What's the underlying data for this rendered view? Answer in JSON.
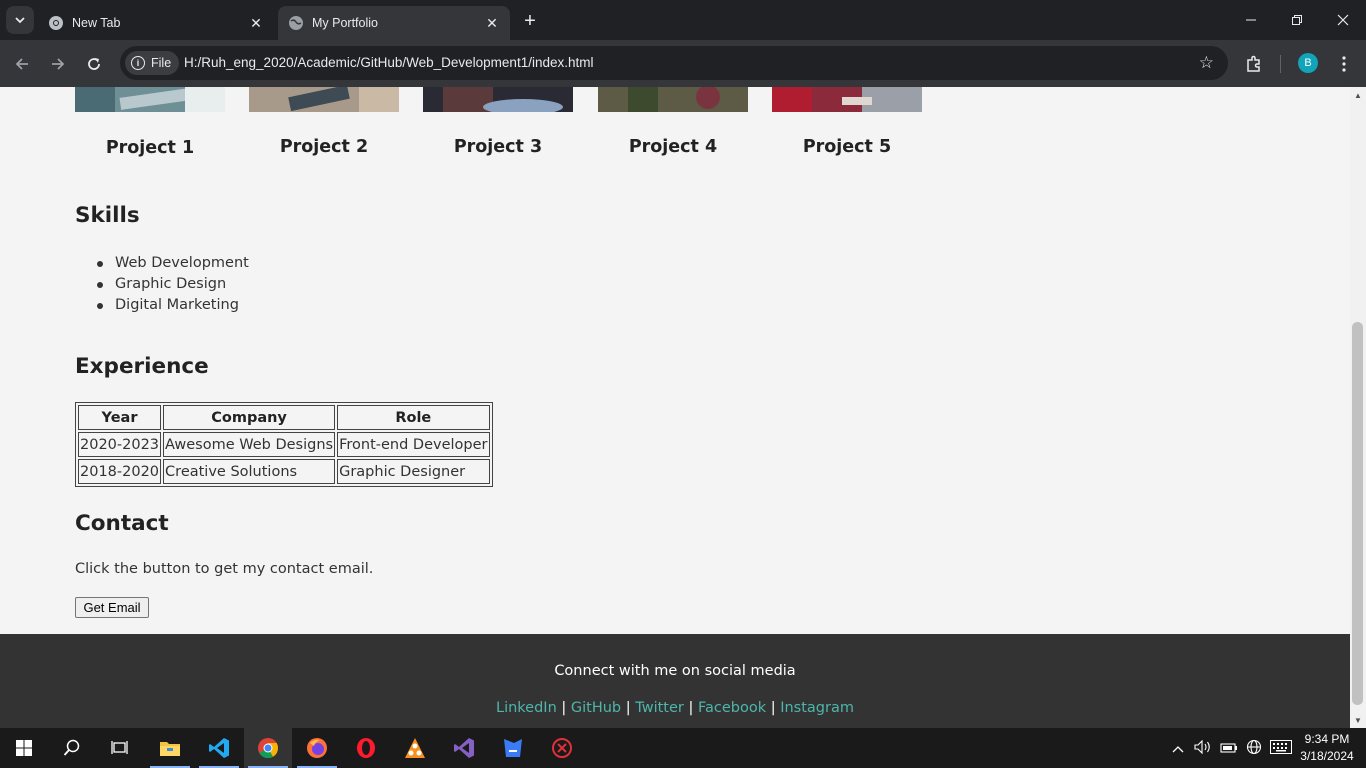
{
  "browser": {
    "tabs": [
      {
        "title": "New Tab",
        "active": false,
        "icon": "chrome-icon"
      },
      {
        "title": "My Portfolio",
        "active": true,
        "icon": "globe-icon"
      }
    ],
    "site_chip": "File",
    "url": "H:/Ruh_eng_2020/Academic/GitHub/Web_Development1/index.html",
    "profile_initial": "B",
    "colors": {
      "frame": "#202124",
      "toolbar": "#35363a",
      "avatar": "#12a4b8"
    }
  },
  "page": {
    "projects": [
      {
        "title": "Project 1",
        "color": "#6f8f96"
      },
      {
        "title": "Project 2",
        "color": "#a89a8a"
      },
      {
        "title": "Project 3",
        "color": "#5a6a80"
      },
      {
        "title": "Project 4",
        "color": "#5d5a45"
      },
      {
        "title": "Project 5",
        "color": "#8a2a3a"
      }
    ],
    "skills": {
      "heading": "Skills",
      "items": [
        "Web Development",
        "Graphic Design",
        "Digital Marketing"
      ]
    },
    "experience": {
      "heading": "Experience",
      "columns": [
        "Year",
        "Company",
        "Role"
      ],
      "rows": [
        [
          "2020-2023",
          "Awesome Web Designs",
          "Front-end Developer"
        ],
        [
          "2018-2020",
          "Creative Solutions",
          "Graphic Designer"
        ]
      ]
    },
    "contact": {
      "heading": "Contact",
      "text": "Click the button to get my contact email.",
      "button": "Get Email"
    },
    "footer": {
      "connect": "Connect with me on social media",
      "links": [
        "LinkedIn",
        "GitHub",
        "Twitter",
        "Facebook",
        "Instagram"
      ],
      "separator": "|",
      "link_color": "#4db6ac",
      "background": "#333333"
    }
  },
  "taskbar": {
    "apps": [
      "start-icon",
      "search-icon",
      "task-view-icon",
      "file-explorer-icon",
      "vscode-icon",
      "chrome-icon",
      "firefox-icon",
      "opera-icon",
      "sourcetree-icon",
      "visual-studio-icon",
      "intellij-icon",
      "app-icon"
    ],
    "time": "9:34 PM",
    "date": "3/18/2024"
  }
}
